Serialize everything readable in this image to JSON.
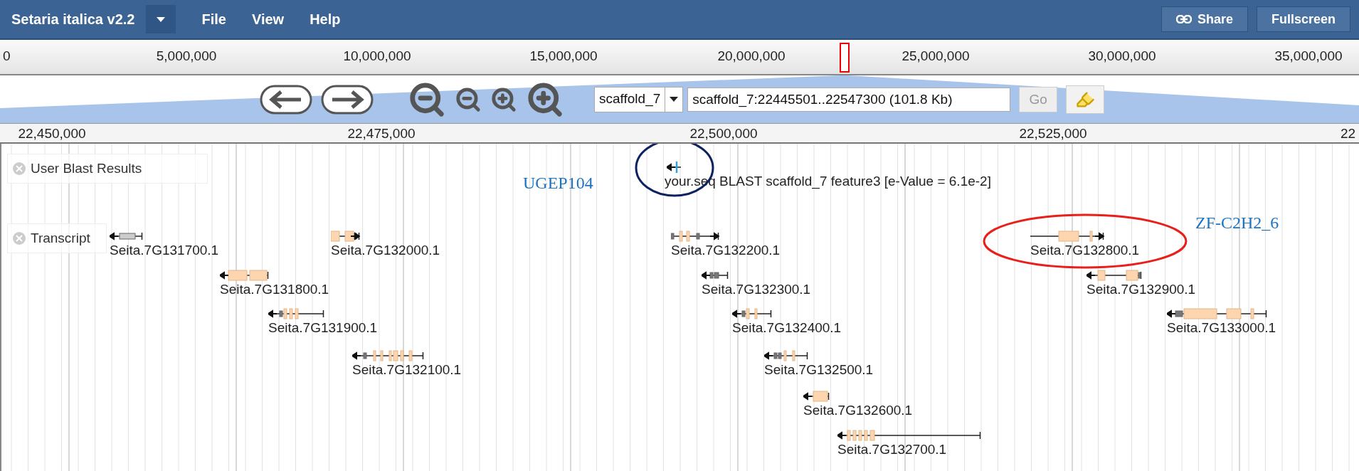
{
  "menu_bar": {
    "title": "Setaria italica v2.2",
    "menus": [
      "File",
      "View",
      "Help"
    ],
    "buttons": [
      {
        "label": "Share",
        "kind": "share"
      },
      {
        "label": "Fullscreen",
        "kind": "plain"
      }
    ]
  },
  "overview": {
    "ticks": [
      "0",
      "5,000,000",
      "10,000,000",
      "15,000,000",
      "20,000,000",
      "25,000,000",
      "30,000,000",
      "35,000,000"
    ]
  },
  "navigation": {
    "reference": "scaffold_7",
    "location": "scaffold_7:22445501..22547300 (101.8 Kb)",
    "go": {
      "label": "Go",
      "disabled": true
    }
  },
  "ruler": {
    "ticks": [
      "22,450,000",
      "22,475,000",
      "22,500,000",
      "22,525,000",
      "22"
    ]
  },
  "tracks": [
    {
      "label": "User Blast Results",
      "features": [
        {
          "name": "your.seq BLAST scaffold_7 feature3 [e-Value = 6.1e-2]",
          "reverse": true
        }
      ]
    },
    {
      "label": "Transcript",
      "features": [
        {
          "name": "Seita.7G131700.1",
          "reverse": true
        },
        {
          "name": "Seita.7G132000.1",
          "reverse": false
        },
        {
          "name": "Seita.7G131800.1",
          "reverse": true
        },
        {
          "name": "Seita.7G131900.1",
          "reverse": true
        },
        {
          "name": "Seita.7G132100.1",
          "reverse": true
        },
        {
          "name": "Seita.7G132200.1",
          "reverse": false
        },
        {
          "name": "Seita.7G132300.1",
          "reverse": true
        },
        {
          "name": "Seita.7G132400.1",
          "reverse": true
        },
        {
          "name": "Seita.7G132500.1",
          "reverse": true
        },
        {
          "name": "Seita.7G132600.1",
          "reverse": true
        },
        {
          "name": "Seita.7G132700.1",
          "reverse": true
        },
        {
          "name": "Seita.7G132800.1",
          "reverse": false
        },
        {
          "name": "Seita.7G132900.1",
          "reverse": true
        },
        {
          "name": "Seita.7G133000.1",
          "reverse": true
        }
      ]
    }
  ],
  "annotations": [
    {
      "text": "UGEP104",
      "color": "#0d2260"
    },
    {
      "text": "ZF-C2H2_6",
      "color": "#e8201c"
    }
  ]
}
